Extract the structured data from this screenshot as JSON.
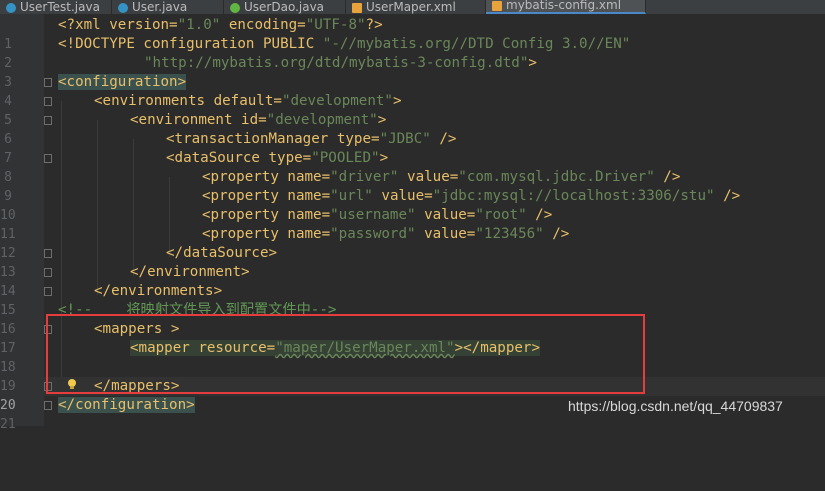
{
  "tabs": [
    {
      "label": "UserTest.java",
      "icon": "java-class-icon",
      "color": "#3592c4",
      "active": false
    },
    {
      "label": "User.java",
      "icon": "java-class-icon",
      "color": "#3592c4",
      "active": false
    },
    {
      "label": "UserDao.java",
      "icon": "java-interface-icon",
      "color": "#62b543",
      "active": false
    },
    {
      "label": "UserMaper.xml",
      "icon": "xml-file-icon",
      "color": "#e8a33d",
      "active": false
    },
    {
      "label": "mybatis-config.xml",
      "icon": "xml-file-icon",
      "color": "#e8a33d",
      "active": true
    }
  ],
  "lines": {
    "l1": {
      "num": "1",
      "p1": "<?xml version=",
      "p2": "\"1.0\"",
      "p3": " encoding=",
      "p4": "\"UTF-8\"",
      "p5": "?>"
    },
    "l2": {
      "num": "2",
      "p1": "<!DOCTYPE configuration PUBLIC ",
      "p2": "\"-//mybatis.org//DTD Config 3.0//EN\""
    },
    "l3": {
      "num": "3",
      "p1": "\"http://mybatis.org/dtd/mybatis-3-config.dtd\"",
      "p2": ">"
    },
    "l4": {
      "num": "4",
      "p1": "<configuration>"
    },
    "l5": {
      "num": "5",
      "p1": "<environments ",
      "p2": "default=",
      "p3": "\"development\"",
      "p4": ">"
    },
    "l6": {
      "num": "6",
      "p1": "<environment ",
      "p2": "id=",
      "p3": "\"development\"",
      "p4": ">"
    },
    "l7": {
      "num": "7",
      "p1": "<transactionManager ",
      "p2": "type=",
      "p3": "\"JDBC\"",
      "p4": " />"
    },
    "l8": {
      "num": "8",
      "p1": "<dataSource ",
      "p2": "type=",
      "p3": "\"POOLED\"",
      "p4": ">"
    },
    "l9": {
      "num": "9",
      "p1": "<property ",
      "p2": "name=",
      "p3": "\"driver\"",
      "p4": " value=",
      "p5": "\"com.mysql.jdbc.Driver\"",
      "p6": " />"
    },
    "l10": {
      "num": "10",
      "p1": "<property ",
      "p2": "name=",
      "p3": "\"url\"",
      "p4": " value=",
      "p5": "\"jdbc:mysql://localhost:3306/stu\"",
      "p6": " />"
    },
    "l11": {
      "num": "11",
      "p1": "<property ",
      "p2": "name=",
      "p3": "\"username\"",
      "p4": " value=",
      "p5": "\"root\"",
      "p6": " />"
    },
    "l12": {
      "num": "12",
      "p1": "<property ",
      "p2": "name=",
      "p3": "\"password\"",
      "p4": " value=",
      "p5": "\"123456\"",
      "p6": " />"
    },
    "l13": {
      "num": "13",
      "p1": "</dataSource>"
    },
    "l14": {
      "num": "14",
      "p1": "</environment>"
    },
    "l15": {
      "num": "15",
      "p1": "</environments>"
    },
    "l16": {
      "num": "16",
      "p1": "<!--    将映射文件导入到配置文件中-->"
    },
    "l17": {
      "num": "17",
      "p1": "<mappers ",
      "p2": ">"
    },
    "l18": {
      "num": "18",
      "p1": "<mapper ",
      "p2": "resource=",
      "p3": "\"maper/UserMaper.xml\"",
      "p4": "></mapper>"
    },
    "l19": {
      "num": "19"
    },
    "l20": {
      "num": "20",
      "p1": "</mappers>"
    },
    "l21": {
      "num": "21",
      "p1": "</configuration>"
    }
  },
  "watermark": "https://blog.csdn.net/qq_44709837"
}
